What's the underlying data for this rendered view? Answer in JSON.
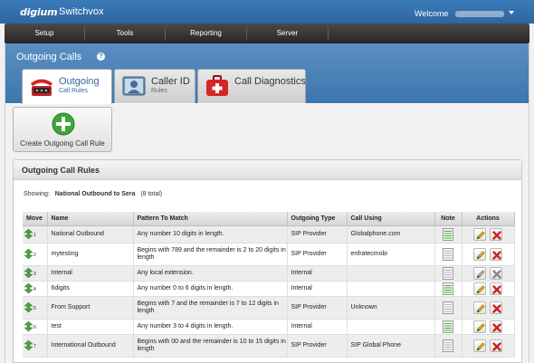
{
  "brand": {
    "logo": "digium",
    "product": "Switchvox",
    "welcome": "Welcome"
  },
  "nav": [
    "Setup",
    "Tools",
    "Reporting",
    "Server"
  ],
  "page": {
    "title": "Outgoing Calls",
    "help_icon": "help-icon"
  },
  "tabs": [
    {
      "label": "Outgoing",
      "sub": "Call Rules",
      "icon": "phone-icon",
      "active": true
    },
    {
      "label": "Caller ID",
      "sub": "Rules",
      "icon": "caller-id-icon",
      "active": false
    },
    {
      "label": "Call Diagnostics",
      "sub": "",
      "icon": "first-aid-kit-icon",
      "active": false
    }
  ],
  "create_button": {
    "label": "Create Outgoing Call Rule",
    "icon": "plus-icon"
  },
  "panel": {
    "title": "Outgoing Call Rules",
    "showing_label": "Showing:",
    "showing_value": "National Outbound to Sera",
    "showing_total": "(8 total)"
  },
  "table": {
    "columns": [
      "Move",
      "Name",
      "Pattern To Match",
      "Outgoing Type",
      "Call Using",
      "Note",
      "Actions"
    ],
    "rows": [
      {
        "num": "1",
        "name": "National Outbound",
        "pattern": "Any number 10 digits in length.",
        "type": "SIP Provider",
        "using": "Globalphone.com",
        "note": true,
        "editable": true,
        "deletable": true
      },
      {
        "num": "2",
        "name": "mytesting",
        "pattern": "Begins with 789 and the remainder is 2 to 20 digits in length",
        "type": "SIP Provider",
        "using": "enfratecmobi",
        "note": false,
        "editable": true,
        "deletable": true
      },
      {
        "num": "3",
        "name": "Internal",
        "pattern": "Any local extension.",
        "type": "Internal",
        "using": "",
        "note": false,
        "editable": false,
        "deletable": false
      },
      {
        "num": "4",
        "name": "6digits",
        "pattern": "Any number 0 to 6 digits in length.",
        "type": "Internal",
        "using": "",
        "note": true,
        "editable": true,
        "deletable": true
      },
      {
        "num": "5",
        "name": "From Support",
        "pattern": "Begins with 7 and the remainder is 7 to 12 digits in length",
        "type": "SIP Provider",
        "using": "Unknown",
        "note": false,
        "editable": true,
        "deletable": true
      },
      {
        "num": "6",
        "name": "test",
        "pattern": "Any number 3 to 4 digits in length.",
        "type": "Internal",
        "using": "",
        "note": true,
        "editable": true,
        "deletable": true
      },
      {
        "num": "7",
        "name": "International Outbound",
        "pattern": "Begins with 00 and the remainder is 10 to 15 digits in length",
        "type": "SIP Provider",
        "using": "SIP Global Phone",
        "note": false,
        "editable": true,
        "deletable": true
      }
    ]
  },
  "colors": {
    "brand_blue": "#2e66a0",
    "nav_dark": "#262626",
    "active_tab_text": "#2d67a5",
    "delete_red": "#d21f1f",
    "edit_yellow": "#e2a11a"
  }
}
